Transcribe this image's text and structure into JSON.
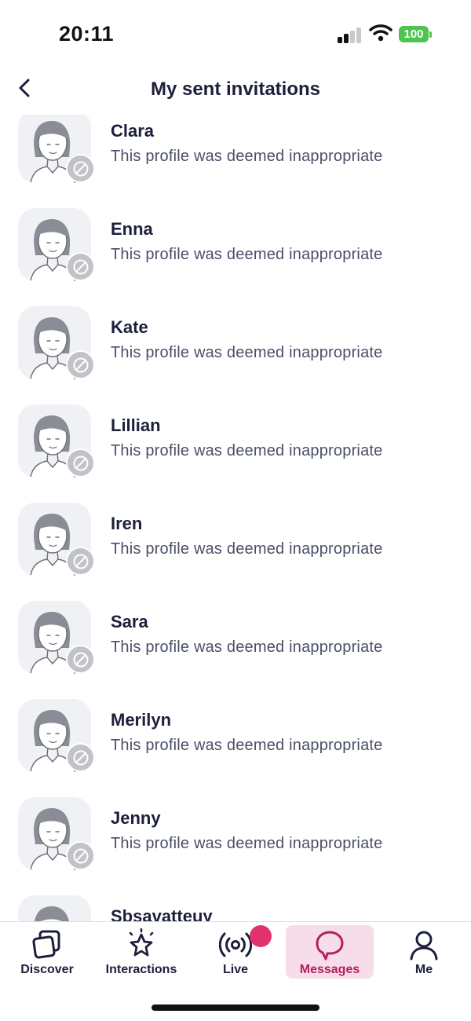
{
  "status_bar": {
    "time": "20:11",
    "battery": "100",
    "battery_color": "#4cc44e"
  },
  "header": {
    "back_icon": "chevron-left-icon",
    "title": "My sent invitations"
  },
  "invitations": [
    {
      "name": "Clara",
      "status": "This profile was deemed inappropriate"
    },
    {
      "name": "Enna",
      "status": "This profile was deemed inappropriate"
    },
    {
      "name": "Kate",
      "status": "This profile was deemed inappropriate"
    },
    {
      "name": "Lillian",
      "status": "This profile was deemed inappropriate"
    },
    {
      "name": "Iren",
      "status": "This profile was deemed inappropriate"
    },
    {
      "name": "Sara",
      "status": "This profile was deemed inappropriate"
    },
    {
      "name": "Merilyn",
      "status": "This profile was deemed inappropriate"
    },
    {
      "name": "Jenny",
      "status": "This profile was deemed inappropriate"
    },
    {
      "name": "Sbsavatteuy",
      "status": ""
    }
  ],
  "bottom_nav": {
    "items": [
      {
        "label": "Discover",
        "icon": "cards-icon"
      },
      {
        "label": "Interactions",
        "icon": "sparkle-star-icon"
      },
      {
        "label": "Live",
        "icon": "broadcast-icon"
      },
      {
        "label": "Messages",
        "icon": "chat-bubble-icon"
      },
      {
        "label": "Me",
        "icon": "person-icon"
      }
    ],
    "active": "Messages",
    "active_color": "#b3205f",
    "notification_color": "#e0336f"
  }
}
